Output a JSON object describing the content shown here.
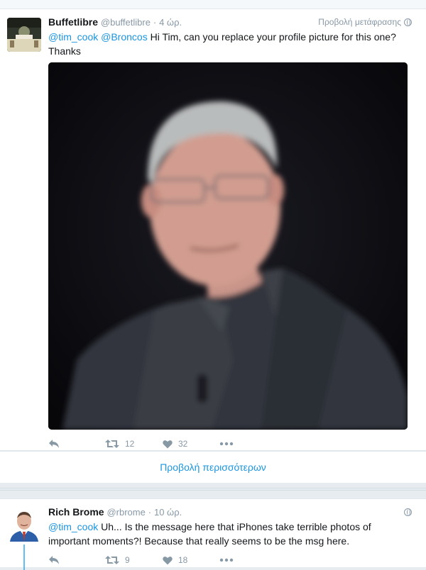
{
  "tweet1": {
    "name": "Buffetlibre",
    "handle": "@buffetlibre",
    "separator": "·",
    "time": "4 ώρ.",
    "translate_label": "Προβολή μετάφρασης",
    "mention1": "@tim_cook",
    "mention2": "@Broncos",
    "text_body": " Hi Tim, can you replace your profile picture for this one? Thanks",
    "retweet_count": "12",
    "like_count": "32"
  },
  "show_more": {
    "label": "Προβολή περισσότερων"
  },
  "tweet2": {
    "name": "Rich Brome",
    "handle": "@rbrome",
    "separator": "·",
    "time": "10 ώρ.",
    "mention1": "@tim_cook",
    "text_body": " Uh... Is the message here that iPhones take terrible photos of important moments?! Because that really seems to be the msg here.",
    "retweet_count": "9",
    "like_count": "18"
  },
  "colors": {
    "link": "#1b95e0",
    "muted": "#8899a6",
    "background": "#e6ecf0",
    "card": "#ffffff"
  },
  "icons": [
    "reply-icon",
    "retweet-icon",
    "heart-icon",
    "more-icon",
    "globe-icon"
  ]
}
